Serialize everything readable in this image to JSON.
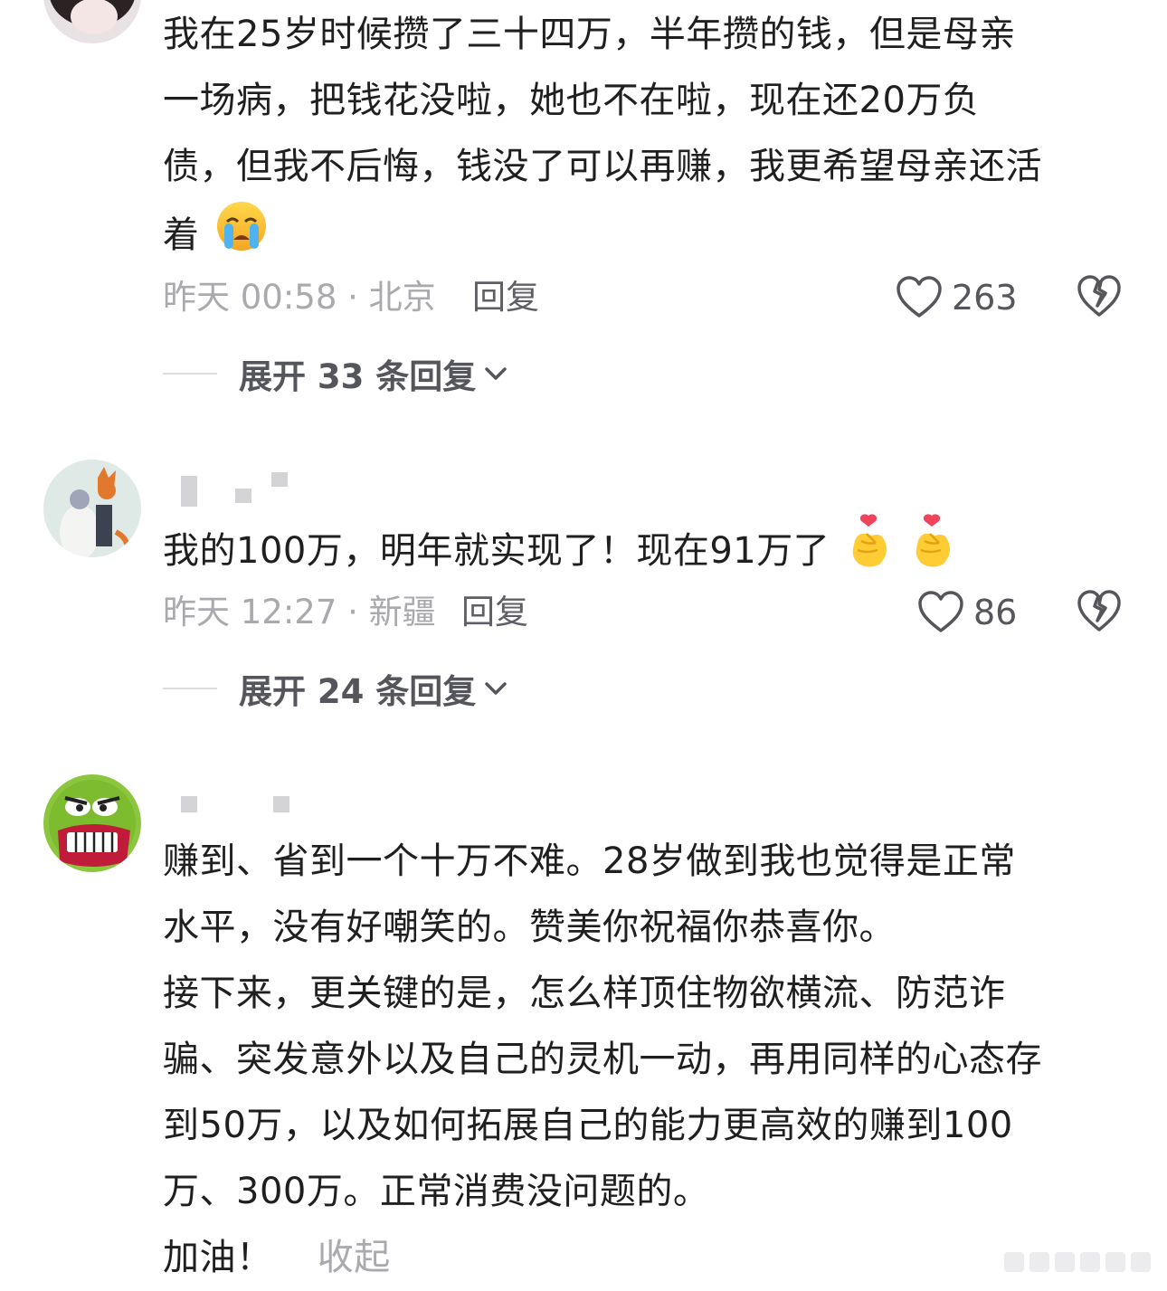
{
  "comments": [
    {
      "lines": [
        "我在25岁时候攒了三十四万，半年攒的钱，但是母亲",
        "一场病，把钱花没啦，她也不在啦，现在还20万负",
        "债，但我不后悔，钱没了可以再赚，我更希望母亲还活",
        "着"
      ],
      "emoji": "loudly-crying-face",
      "time": "昨天 00:58 · 北京",
      "reply_label": "回复",
      "likes": "263",
      "expand_label": "展开 33 条回复"
    },
    {
      "lines": [
        "我的100万，明年就实现了！现在91万了"
      ],
      "emoji": "finger-heart",
      "time": "昨天 12:27 · 新疆",
      "reply_label": "回复",
      "likes": "86",
      "expand_label": "展开 24 条回复"
    },
    {
      "lines": [
        "赚到、省到一个十万不难。28岁做到我也觉得是正常",
        "水平，没有好嘲笑的。赞美你祝福你恭喜你。",
        "接下来，更关键的是，怎么样顶住物欲横流、防范诈",
        "骗、突发意外以及自己的灵机一动，再用同样的心态存",
        "到50万，以及如何拓展自己的能力更高效的赚到100",
        "万、300万。正常消费没问题的。",
        "加油！"
      ],
      "collapse_label": "收起"
    }
  ],
  "colors": {
    "text": "#1f1f1f",
    "meta": "#a9a9ae",
    "action": "#5e5e66",
    "heart": "#55555c"
  }
}
